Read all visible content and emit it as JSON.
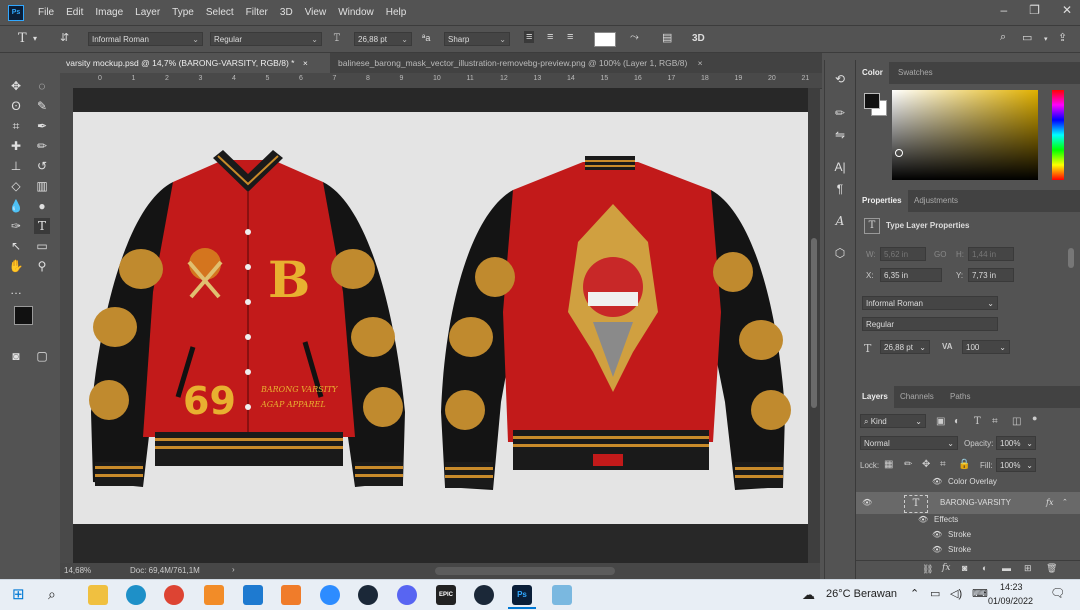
{
  "menu": {
    "items": [
      "File",
      "Edit",
      "Image",
      "Layer",
      "Type",
      "Select",
      "Filter",
      "3D",
      "View",
      "Window",
      "Help"
    ]
  },
  "options": {
    "font_family": "Informal Roman",
    "font_style": "Regular",
    "font_size": "26,88 pt",
    "antialias": "Sharp"
  },
  "tabs": [
    {
      "label": "varsity mockup.psd @ 14,7% (BARONG-VARSITY, RGB/8) *",
      "close": "×"
    },
    {
      "label": "balinese_barong_mask_vector_illustration-removebg-preview.png @ 100% (Layer 1, RGB/8)",
      "close": "×"
    }
  ],
  "ruler": {
    "ticks": [
      "0",
      "1",
      "2",
      "3",
      "4",
      "5",
      "6",
      "7",
      "8",
      "9",
      "10",
      "11",
      "12",
      "13",
      "14",
      "15",
      "16",
      "17",
      "18",
      "19",
      "20",
      "21"
    ]
  },
  "status": {
    "zoom": "14,68%",
    "doc": "Doc: 69,4M/761,1M",
    "arrow": "›"
  },
  "color_panel": {
    "tabs": [
      "Color",
      "Swatches"
    ],
    "fg_color": "#111111",
    "bg_color": "#ffffff",
    "hue_color": "#e0b000"
  },
  "properties": {
    "tabs": [
      "Properties",
      "Adjustments"
    ],
    "type_title": "Type Layer Properties",
    "w_label": "W:",
    "w_value": "5,62 in",
    "go_label": "GO",
    "h_label": "H:",
    "h_value": "1,44 in",
    "x_label": "X:",
    "x_value": "6,35 in",
    "y_label": "Y:",
    "y_value": "7,73 in",
    "font_family": "Informal Roman",
    "font_style": "Regular",
    "font_size": "26,88 pt",
    "tracking": "100"
  },
  "layers": {
    "tabs": [
      "Layers",
      "Channels",
      "Paths"
    ],
    "filter": "Kind",
    "blend_mode": "Normal",
    "opacity_label": "Opacity:",
    "opacity": "100%",
    "lock_label": "Lock:",
    "fill_label": "Fill:",
    "fill": "100%",
    "rows": [
      {
        "name": "Color Overlay"
      },
      {
        "name": "BARONG-VARSITY",
        "fx": "fx"
      },
      {
        "name": "Effects"
      },
      {
        "name": "Stroke"
      },
      {
        "name": "Stroke"
      }
    ]
  },
  "jacket": {
    "front_letter": "B",
    "front_number": "69",
    "front_text_1": "BARONG VARSITY",
    "front_text_2": "AGAP APPAREL"
  },
  "taskbar": {
    "weather": "26°C  Berawan",
    "time": "14:23",
    "date": "01/09/2022",
    "apps": [
      "explorer",
      "edge",
      "chrome",
      "app",
      "vscode",
      "xampp",
      "zoom",
      "steam",
      "discord",
      "epic",
      "steam2",
      "photoshop",
      "notepad"
    ]
  }
}
